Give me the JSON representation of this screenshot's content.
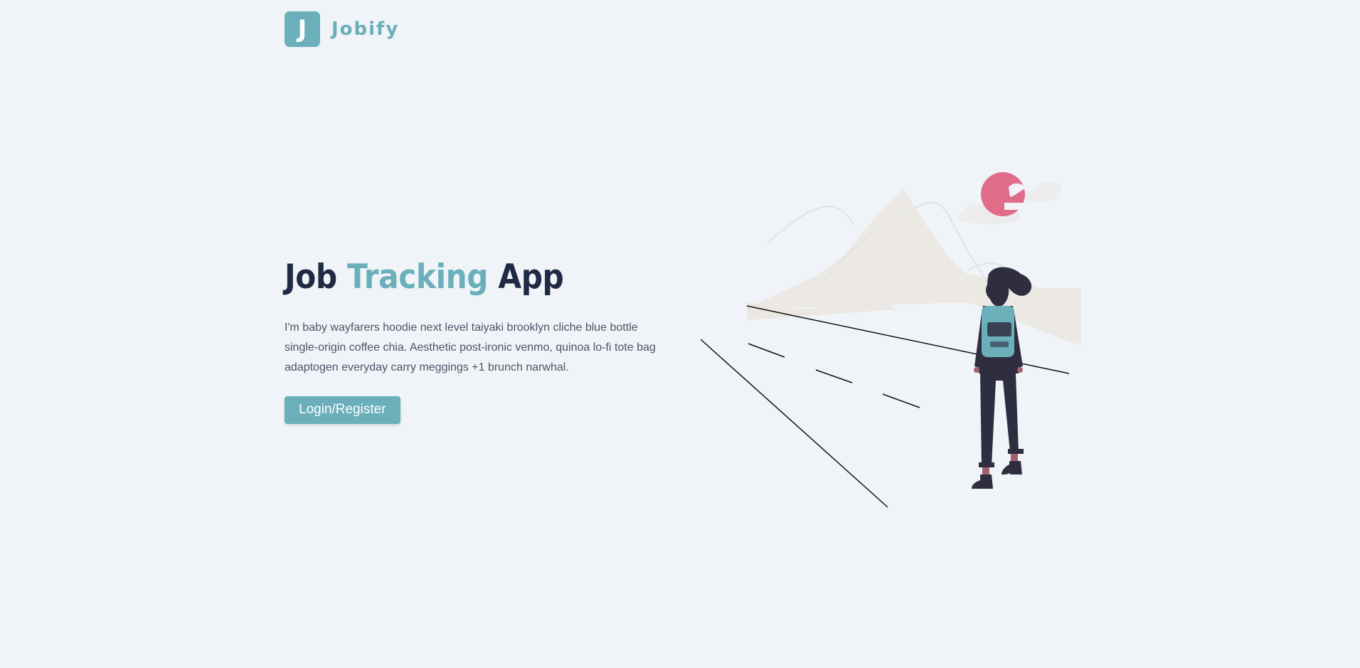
{
  "brand": {
    "logo_letter": "J",
    "name": "Jobify",
    "color": "#6aafba"
  },
  "hero": {
    "title_part1": "Job",
    "title_accent": "Tracking",
    "title_part2": "App",
    "description": "I'm baby wayfarers hoodie next level taiyaki brooklyn cliche blue bottle single-origin coffee chia. Aesthetic post-ironic venmo, quinoa lo-fi tote bag adaptogen everyday carry meggings +1 brunch narwhal.",
    "cta_label": "Login/Register"
  },
  "illustration": {
    "icon": "woman-with-backpack-on-road-illustration",
    "sun_color": "#e06c8a",
    "figure_color": "#2f2e41",
    "backpack_color": "#6aafba"
  },
  "colors": {
    "background": "#f0f4f8",
    "title": "#1f2a44",
    "text": "#4b5567"
  }
}
